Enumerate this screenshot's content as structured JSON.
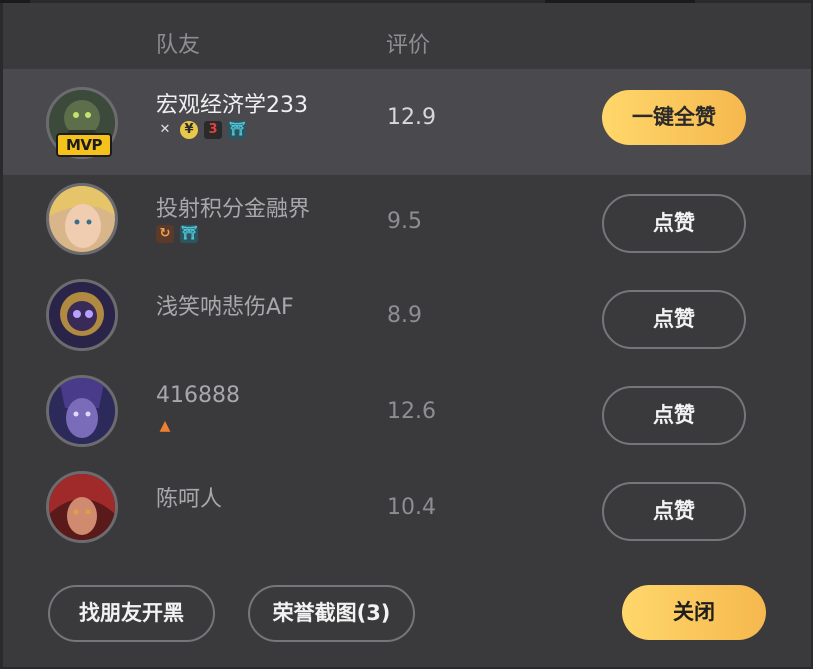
{
  "header": {
    "teammate_label": "队友",
    "rating_label": "评价"
  },
  "players": [
    {
      "name": "宏观经济学233",
      "score": "12.9",
      "mvp": "MVP",
      "action": "一键全赞",
      "badges": [
        {
          "icon": "cross-swords-icon",
          "glyph": "✕",
          "color": "#e0e0e0"
        },
        {
          "icon": "coin-icon",
          "glyph": "¥",
          "color": "#e8c74a"
        },
        {
          "icon": "three-kills-icon",
          "glyph": "3",
          "color": "#e04040"
        },
        {
          "icon": "gate-icon",
          "glyph": "⛩",
          "color": "#4ec7d8"
        }
      ]
    },
    {
      "name": "投射积分金融界",
      "score": "9.5",
      "action": "点赞",
      "badges": [
        {
          "icon": "hook-icon",
          "glyph": "↻",
          "color": "#f0a050"
        },
        {
          "icon": "gate-icon",
          "glyph": "⛩",
          "color": "#4ec7d8"
        }
      ]
    },
    {
      "name": "浅笑呐悲伤AF",
      "score": "8.9",
      "action": "点赞",
      "badges": []
    },
    {
      "name": "416888",
      "score": "12.6",
      "action": "点赞",
      "badges": [
        {
          "icon": "fire-icon",
          "glyph": "🔥",
          "color": "#f08030"
        }
      ]
    },
    {
      "name": "陈呵人",
      "score": "10.4",
      "action": "点赞",
      "badges": []
    }
  ],
  "footer": {
    "find_friends": "找朋友开黑",
    "honor_screenshot": "荣誉截图(3)",
    "close": "关闭"
  }
}
